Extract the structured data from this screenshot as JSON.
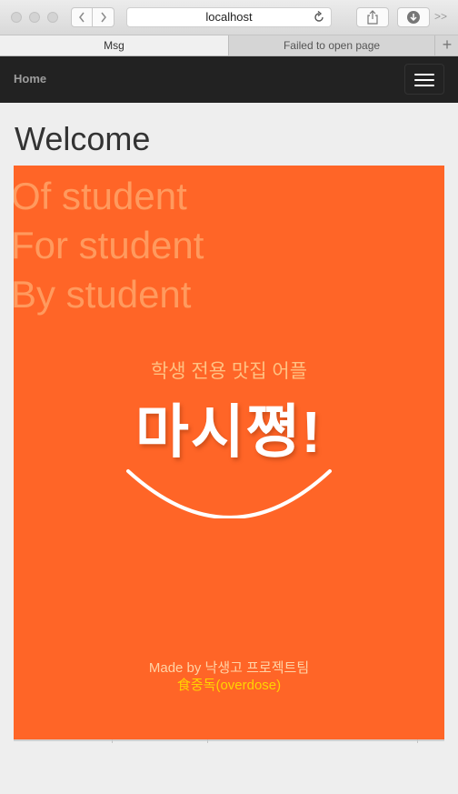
{
  "browser": {
    "url": "localhost",
    "tabs": [
      {
        "label": "Msg"
      },
      {
        "label": "Failed to open page"
      }
    ],
    "new_tab": "+",
    "more": ">>"
  },
  "navbar": {
    "brand": "Home"
  },
  "page": {
    "heading": "Welcome"
  },
  "poster": {
    "slogan": [
      "Of student",
      "For student",
      "By student"
    ],
    "subtitle": "학생 전용 맛집 어플",
    "title": "마시쪙!",
    "credit": "Made by 낙생고 프로젝트팀",
    "team": "食중독(overdose)"
  },
  "colors": {
    "poster_bg": "#ff6527",
    "navbar_bg": "#222222",
    "slogan": "#ff9a5e",
    "subtitle": "#ffc182",
    "team": "#ffd400"
  }
}
